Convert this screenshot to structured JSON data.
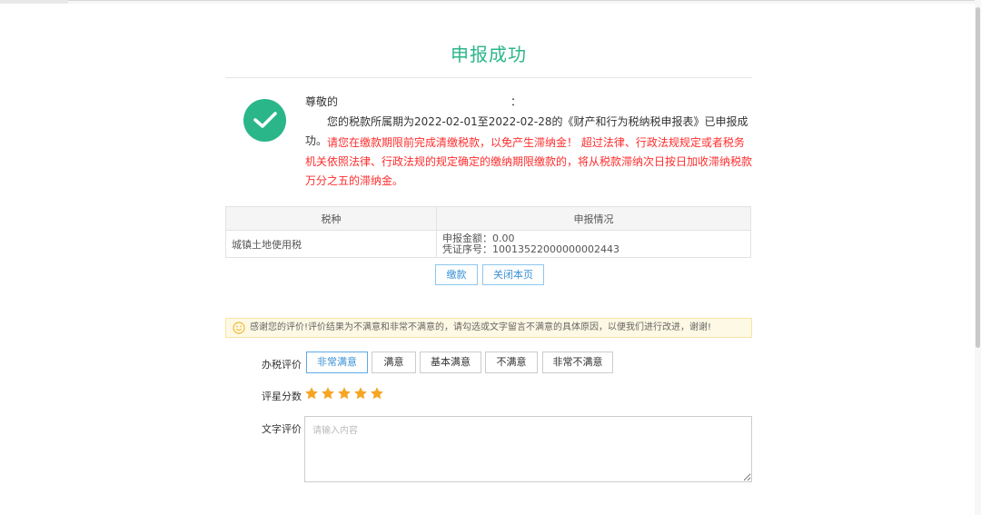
{
  "page": {
    "title": "申报成功",
    "accent_color": "#2bb68a",
    "warning_color": "#ff2d2d"
  },
  "message": {
    "greeting": "尊敬的",
    "greeting_suffix": "：",
    "success": "您的税款所属期为2022-02-01至2022-02-28的《财产和行为税纳税申报表》已申报成功。",
    "warning": "请您在缴款期限前完成清缴税款，以免产生滞纳金！ 超过法律、行政法规规定或者税务机关依照法律、行政法规的规定确定的缴纳期限缴款的，将从税款滞纳次日按日加收滞纳税款万分之五的滞纳金。"
  },
  "result_table": {
    "headers": [
      "税种",
      "申报情况"
    ],
    "rows": [
      {
        "tax_type": "城镇土地使用税",
        "amount_line": "申报金额：0.00",
        "voucher_line": "凭证序号：10013522000000002443"
      }
    ]
  },
  "actions": {
    "pay_label": "缴款",
    "close_label": "关闭本页",
    "button_color": "#3a91d6"
  },
  "feedback": {
    "notice": "感谢您的评价!评价结果为不满意和非常不满意的，请勾选或文字留言不满意的具体原因，以便我们进行改进，谢谢!",
    "notice_icon": "smile-icon",
    "rating_label": "办税评价",
    "rating_options": [
      "非常满意",
      "满意",
      "基本满意",
      "不满意",
      "非常不满意"
    ],
    "rating_selected": "非常满意",
    "stars_label": "评星分数",
    "stars_value": 5,
    "stars_max": 5,
    "star_color": "#f5a623",
    "text_label": "文字评价",
    "text_placeholder": "请输入内容"
  }
}
